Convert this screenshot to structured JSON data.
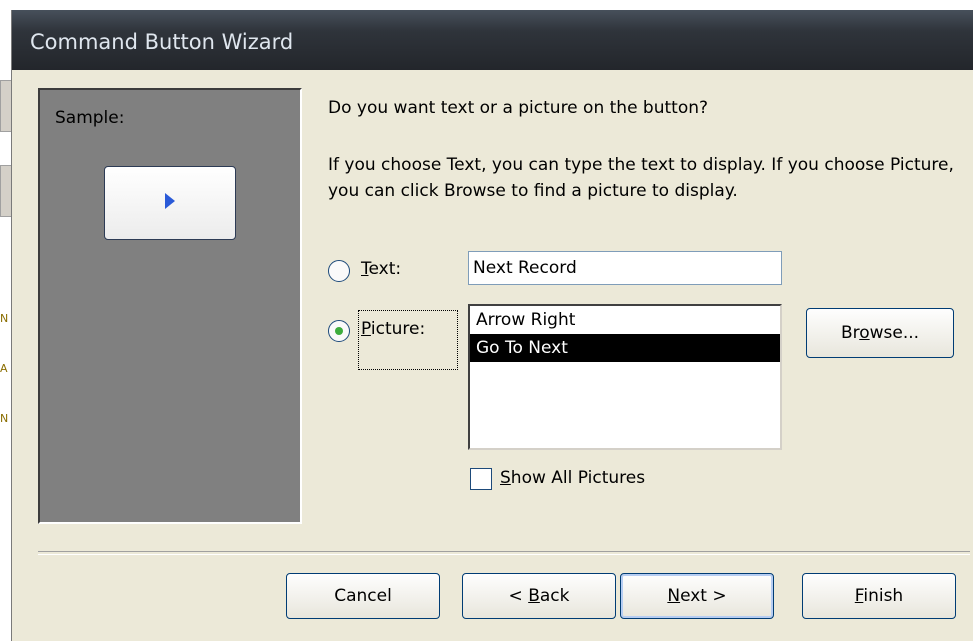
{
  "window": {
    "title": "Command Button Wizard"
  },
  "sample": {
    "label": "Sample:",
    "icon": "arrow-right-icon"
  },
  "question": "Do you want text or a picture on the button?",
  "help": "If you choose Text, you can type the text to display.  If you choose Picture, you can click Browse to find a picture to display.",
  "option_text": {
    "mnemonic": "T",
    "rest": "ext:",
    "selected": false,
    "value": "Next Record"
  },
  "option_picture": {
    "mnemonic": "P",
    "rest": "icture:",
    "selected": true
  },
  "pictures": {
    "items": [
      "Arrow Right",
      "Go To Next"
    ],
    "selected": "Go To Next"
  },
  "browse": {
    "pre": "Br",
    "mnemonic": "o",
    "post": "wse..."
  },
  "show_all": {
    "mnemonic": "S",
    "rest": "how All Pictures",
    "checked": false
  },
  "buttons": {
    "cancel": "Cancel",
    "back": {
      "pre": "< ",
      "mnemonic": "B",
      "post": "ack"
    },
    "next": {
      "mnemonic": "N",
      "post": "ext >"
    },
    "finish": {
      "mnemonic": "F",
      "post": "inish"
    }
  },
  "colors": {
    "titlebar": "#2f343b",
    "dialog": "#ece9d8",
    "sample_panel": "#808080",
    "selection": "#000000",
    "radio_dot": "#3dad3d"
  }
}
